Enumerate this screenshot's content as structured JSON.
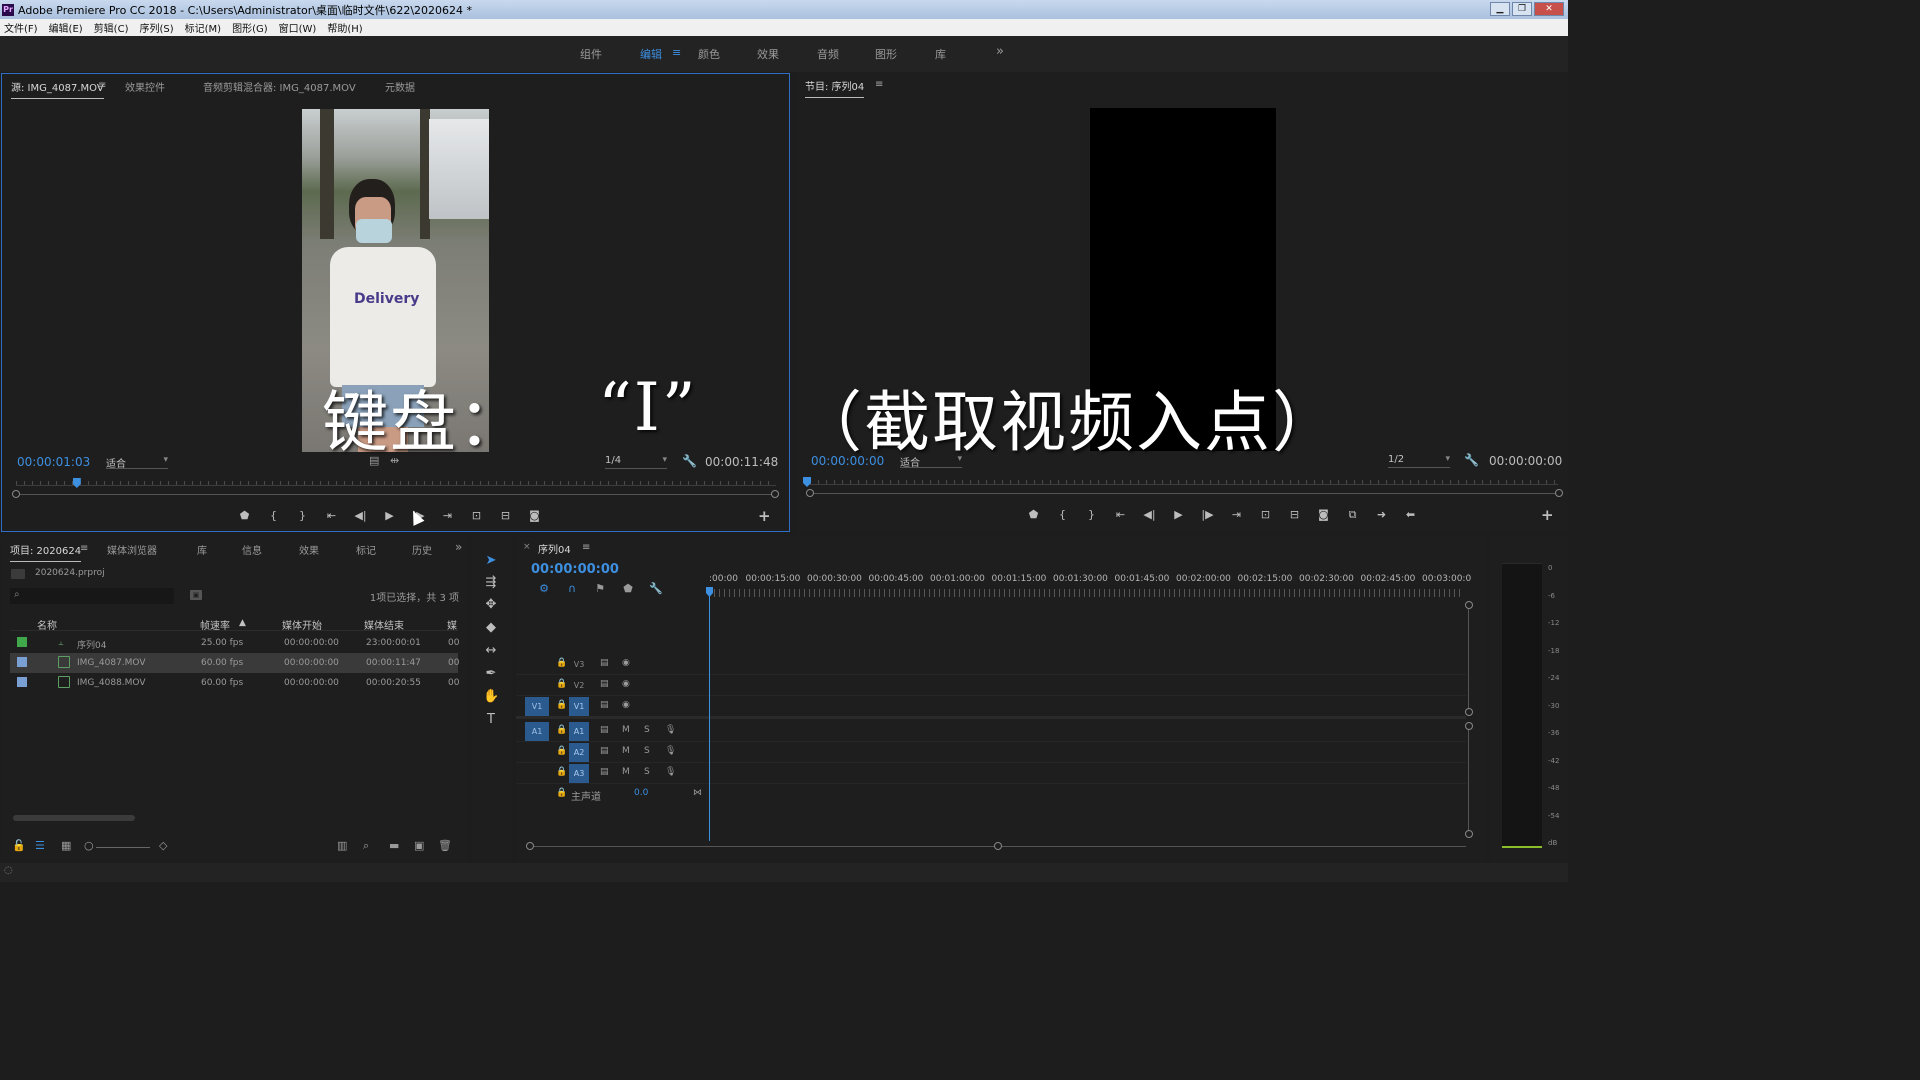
{
  "window": {
    "title": "Adobe Premiere Pro CC 2018 - C:\\Users\\Administrator\\桌面\\临时文件\\622\\2020624 *",
    "app_badge": "Pr"
  },
  "menu": [
    "文件(F)",
    "编辑(E)",
    "剪辑(C)",
    "序列(S)",
    "标记(M)",
    "图形(G)",
    "窗口(W)",
    "帮助(H)"
  ],
  "workspaces": {
    "items": [
      "组件",
      "编辑",
      "颜色",
      "效果",
      "音频",
      "图形",
      "库"
    ],
    "active": "编辑",
    "more": "»"
  },
  "source": {
    "tabs": [
      "源: IMG_4087.MOV",
      "效果控件",
      "音频剪辑混合器: IMG_4087.MOV",
      "元数据"
    ],
    "shirt_text": "Delivery",
    "timecode": "00:00:01:03",
    "fit": "适合",
    "resolution": "1/4",
    "duration": "00:00:11:48",
    "playhead_fraction": 0.08
  },
  "program": {
    "tab": "节目: 序列04",
    "timecode": "00:00:00:00",
    "fit": "适合",
    "resolution": "1/2",
    "duration": "00:00:00:00"
  },
  "project": {
    "tabs": [
      "项目: 2020624",
      "媒体浏览器",
      "库",
      "信息",
      "效果",
      "标记",
      "历史"
    ],
    "more": "»",
    "file": "2020624.prproj",
    "selection": "1项已选择，共 3 项",
    "columns": [
      "名称",
      "帧速率",
      "媒体开始",
      "媒体结束",
      "媒"
    ],
    "rows": [
      {
        "name": "序列04",
        "fps": "25.00 fps",
        "start": "00:00:00:00",
        "end": "23:00:00:01",
        "extra": "00",
        "color": "#3fa84a",
        "selected": false
      },
      {
        "name": "IMG_4087.MOV",
        "fps": "60.00 fps",
        "start": "00:00:00:00",
        "end": "00:00:11:47",
        "extra": "00",
        "color": "#7a9fd4",
        "selected": true
      },
      {
        "name": "IMG_4088.MOV",
        "fps": "60.00 fps",
        "start": "00:00:00:00",
        "end": "00:00:20:55",
        "extra": "00",
        "color": "#7a9fd4",
        "selected": false
      }
    ]
  },
  "timeline": {
    "tab": "序列04",
    "close": "×",
    "timecode": "00:00:00:00",
    "ruler": [
      ":00:00",
      "00:00:15:00",
      "00:00:30:00",
      "00:00:45:00",
      "00:01:00:00",
      "00:01:15:00",
      "00:01:30:00",
      "00:01:45:00",
      "00:02:00:00",
      "00:02:15:00",
      "00:02:30:00",
      "00:02:45:00",
      "00:03:00:0"
    ],
    "video_tracks": [
      "V3",
      "V2",
      "V1"
    ],
    "audio_tracks": [
      "A1",
      "A2",
      "A3"
    ],
    "source_patch_video": "V1",
    "source_patch_audio": "A1",
    "master": {
      "label": "主声道",
      "value": "0.0"
    },
    "mute": "M",
    "solo": "S"
  },
  "meter": {
    "labels": [
      "0",
      "-6",
      "-12",
      "-18",
      "-24",
      "-30",
      "-36",
      "-42",
      "-48",
      "-54",
      "dB"
    ]
  },
  "caption": {
    "part1": "键盘：",
    "part2": "“I”",
    "part3": "（截取视频入点）"
  },
  "colors": {
    "accent": "#3d8fe0",
    "panel": "#1e1e1e",
    "patch": "#2b5b8e"
  }
}
